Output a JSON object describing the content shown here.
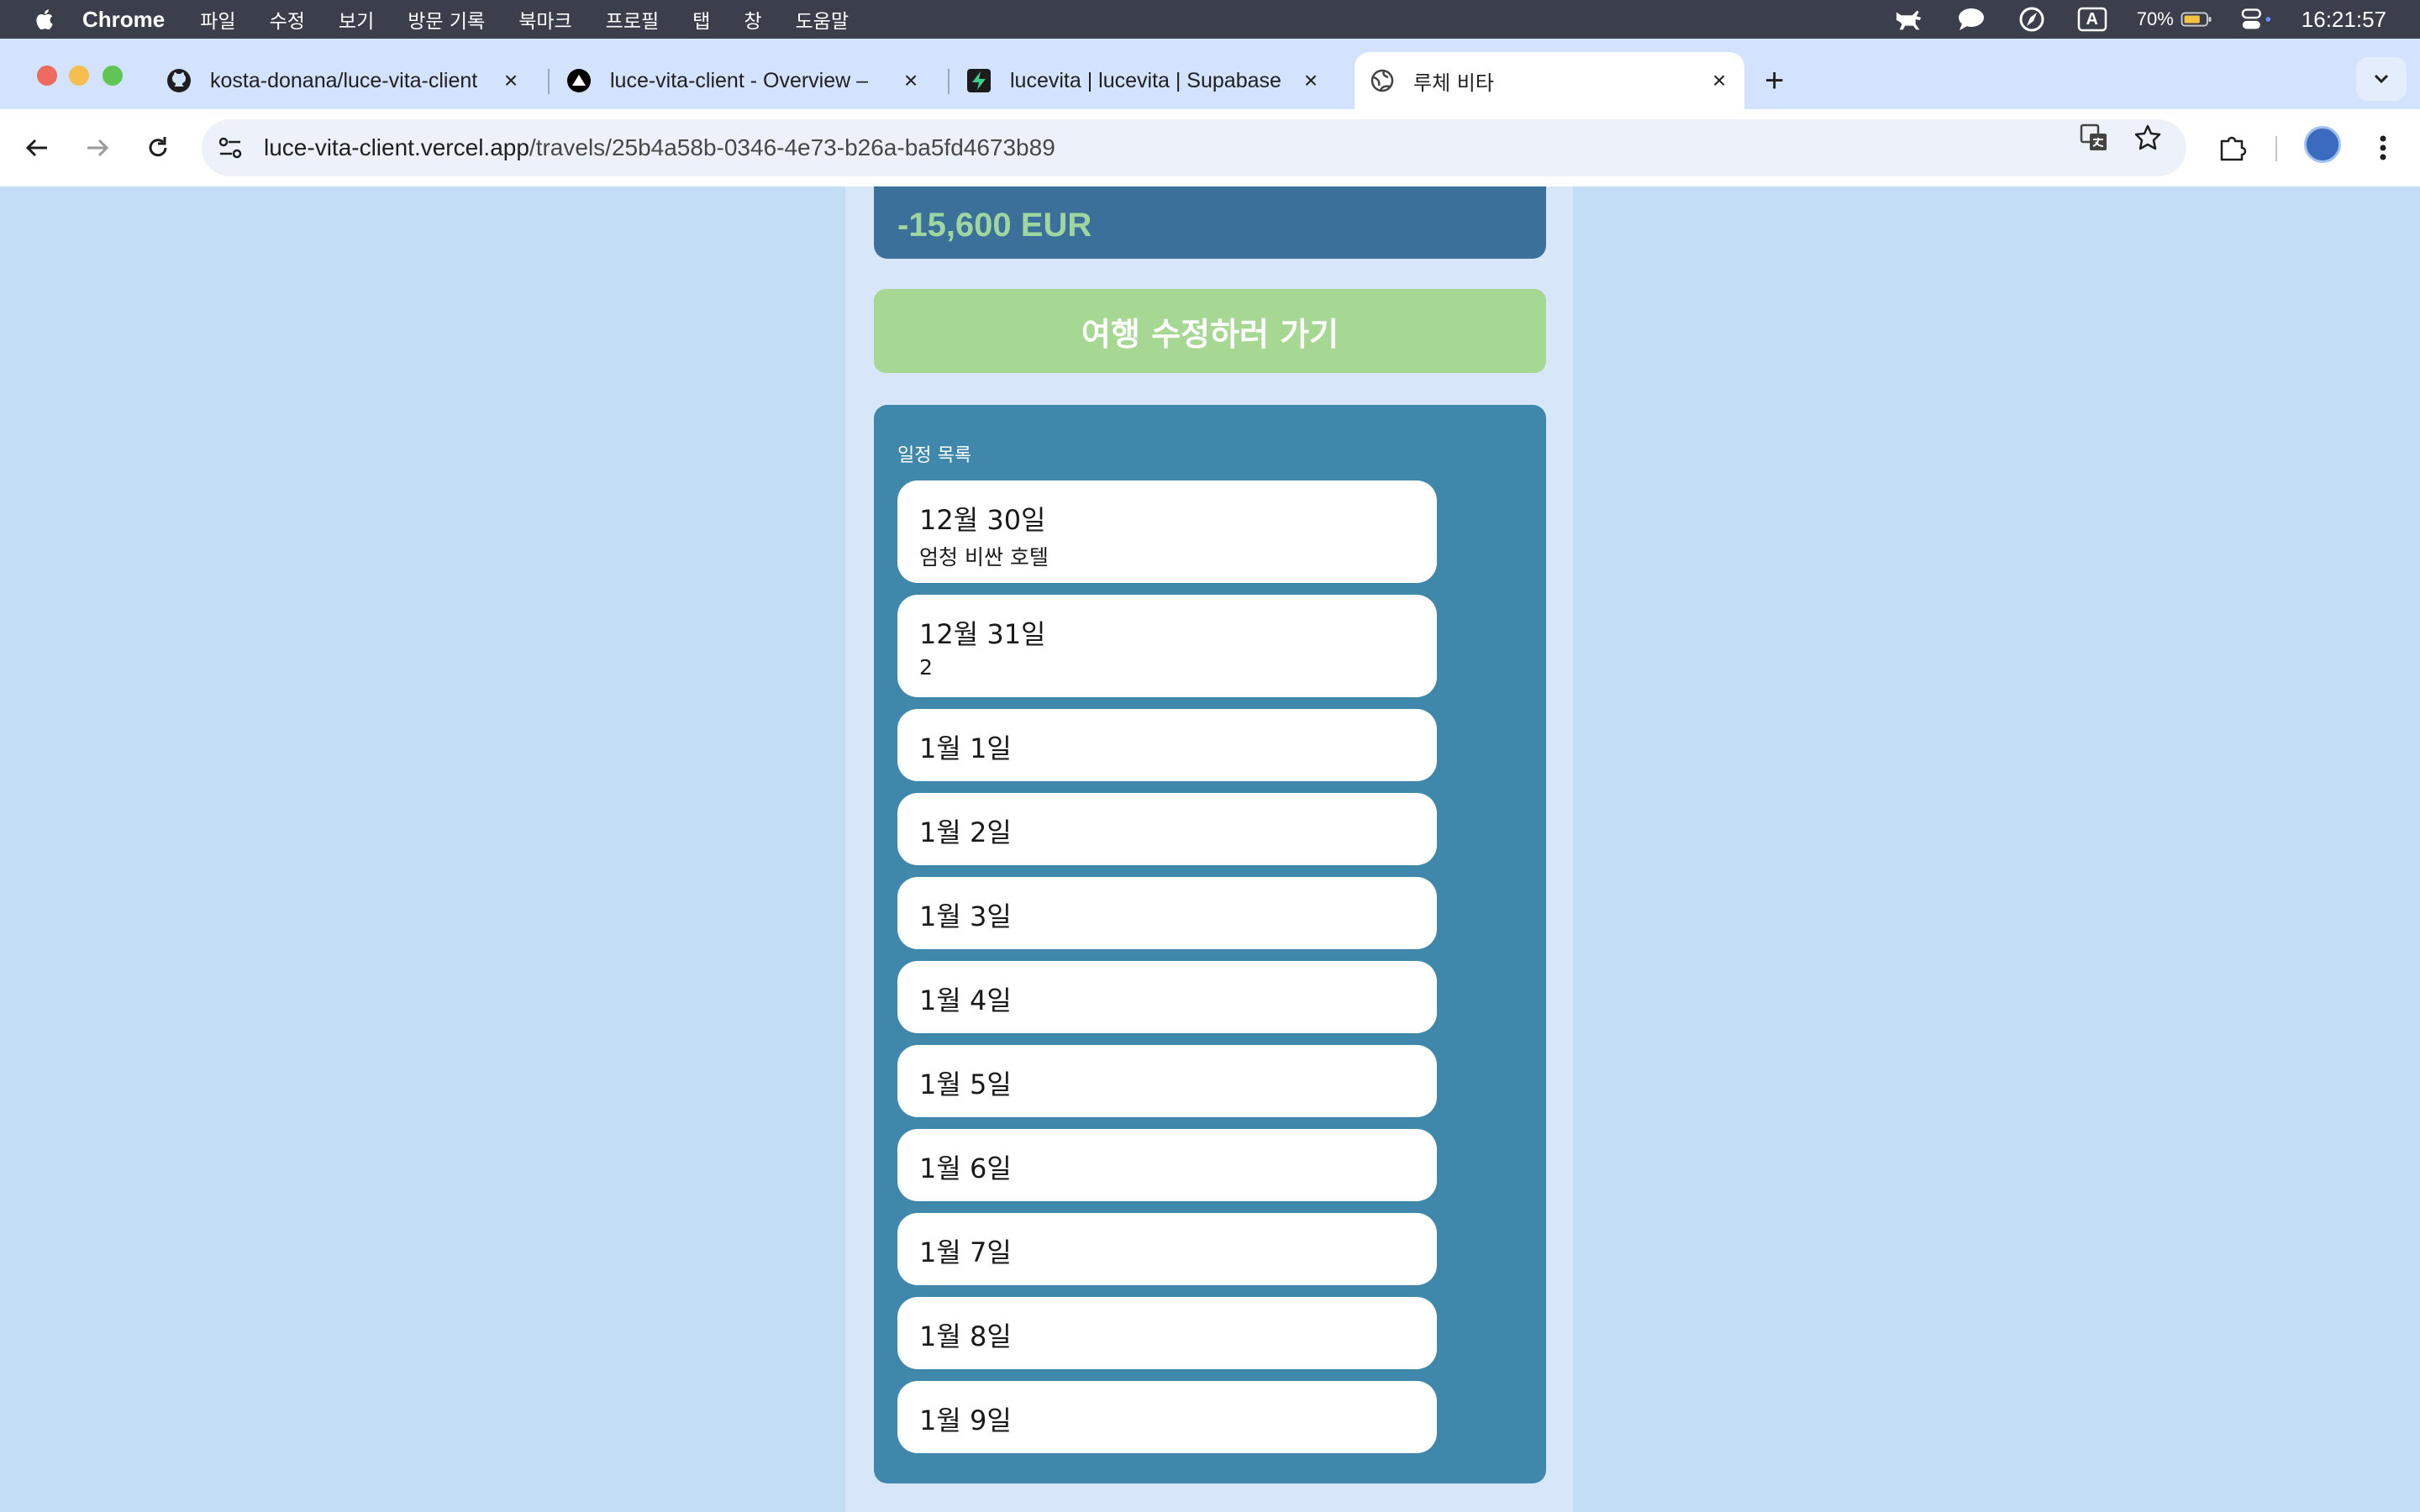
{
  "menubar": {
    "app_name": "Chrome",
    "items": [
      "파일",
      "수정",
      "보기",
      "방문 기록",
      "북마크",
      "프로필",
      "탭",
      "창",
      "도움말"
    ],
    "battery_percent": "70%",
    "clock": "16:21:57",
    "input_source": "A"
  },
  "tabs": [
    {
      "title": "kosta-donana/luce-vita-client",
      "icon": "github-icon",
      "active": false
    },
    {
      "title": "luce-vita-client - Overview – ",
      "icon": "vercel-icon",
      "active": false
    },
    {
      "title": "lucevita | lucevita | Supabase",
      "icon": "supabase-icon",
      "active": false
    },
    {
      "title": "루체 비타",
      "icon": "globe-icon",
      "active": true
    }
  ],
  "address_bar": {
    "host": "luce-vita-client.vercel.app",
    "path": "/travels/25b4a58b-0346-4e73-b26a-ba5fd4673b89"
  },
  "page": {
    "balance": "-15,600 EUR",
    "edit_button_label": "여행 수정하러 가기",
    "schedule_title": "일정 목록",
    "days": [
      {
        "date": "12월 30일",
        "memo": "엄청 비싼 호텔"
      },
      {
        "date": "12월 31일",
        "memo": "2"
      },
      {
        "date": "1월 1일"
      },
      {
        "date": "1월 2일"
      },
      {
        "date": "1월 3일"
      },
      {
        "date": "1월 4일"
      },
      {
        "date": "1월 5일"
      },
      {
        "date": "1월 6일"
      },
      {
        "date": "1월 7일"
      },
      {
        "date": "1월 8일"
      },
      {
        "date": "1월 9일"
      }
    ]
  },
  "colors": {
    "page_bg": "#c3ddf6",
    "column_bg": "#d8e6f9",
    "balance_card": "#3a7099",
    "balance_text": "#9fd6a0",
    "edit_button": "#a6d893",
    "schedule_panel": "#3f88ab"
  }
}
